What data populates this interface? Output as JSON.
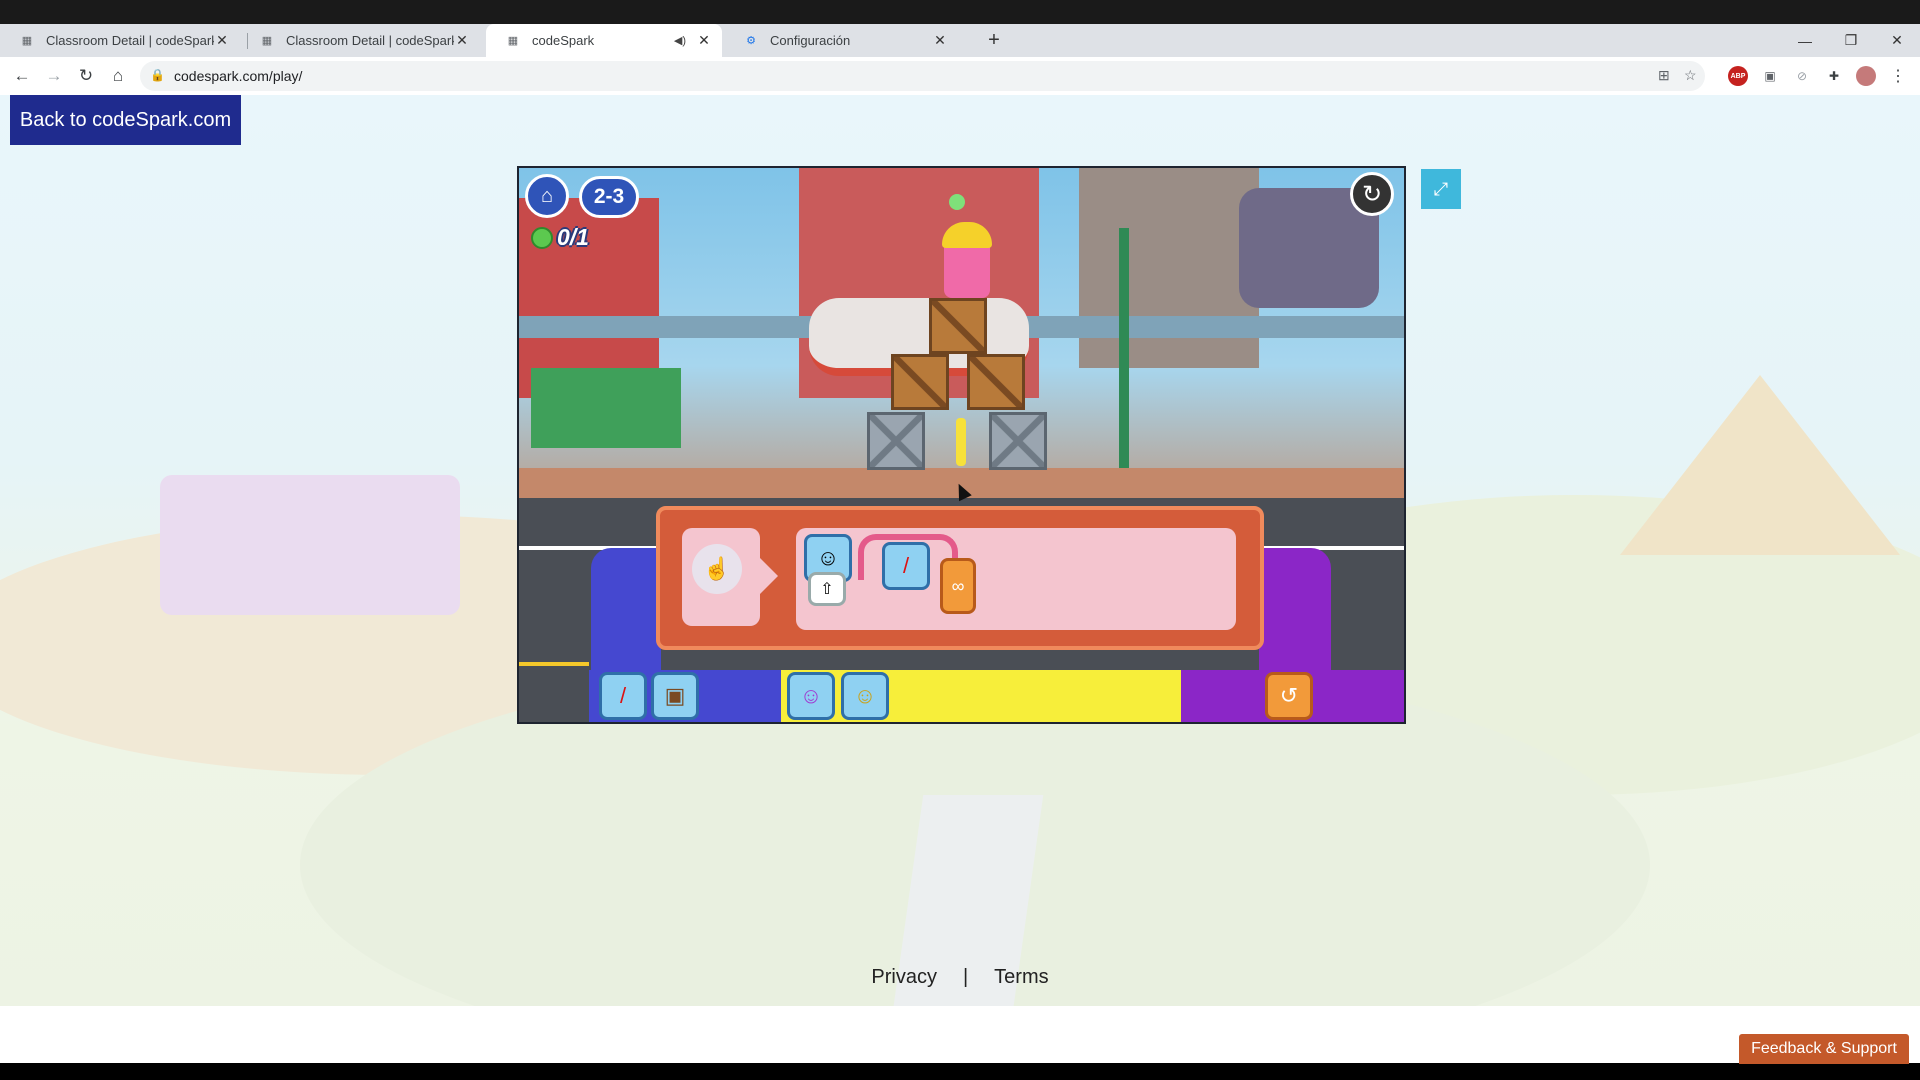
{
  "browser": {
    "tabs": [
      {
        "title": "Classroom Detail | codeSpark Ac",
        "favicon": "codespark-icon",
        "active": false
      },
      {
        "title": "Classroom Detail | codeSpark Ac",
        "favicon": "codespark-icon",
        "active": false
      },
      {
        "title": "codeSpark",
        "favicon": "codespark-icon",
        "active": true,
        "muted_indicator": true
      },
      {
        "title": "Configuración",
        "favicon": "gear-icon",
        "active": false
      }
    ],
    "new_tab_label": "+",
    "url": "codespark.com/play/",
    "extensions": [
      "translate-icon",
      "star-icon",
      "adblock-icon",
      "extension-icon",
      "extension-icon",
      "puzzle-icon",
      "avatar"
    ]
  },
  "page": {
    "back_button_label": "Back to codeSpark.com",
    "footer": {
      "privacy": "Privacy",
      "separator": "|",
      "terms": "Terms"
    },
    "feedback_label": "Feedback & Support"
  },
  "game": {
    "level": "2-3",
    "score": "0/1",
    "home_icon": "home-icon",
    "restart_icon": "restart-icon",
    "program_blocks": [
      "character-block",
      "arrow-up-block",
      "dynamite-block",
      "loop-infinity-block"
    ],
    "tray_left": [
      "dynamite-block",
      "crate-block"
    ],
    "tray_mid": [
      "purple-character-block",
      "yellow-character-block"
    ],
    "tray_right": [
      "loop-block"
    ],
    "colors": {
      "tray_left": "#4548d0",
      "tray_mid": "#f7ee3a",
      "tray_right": "#8b26c7",
      "panel": "#d45c3a",
      "hud": "#2f54b8"
    }
  }
}
